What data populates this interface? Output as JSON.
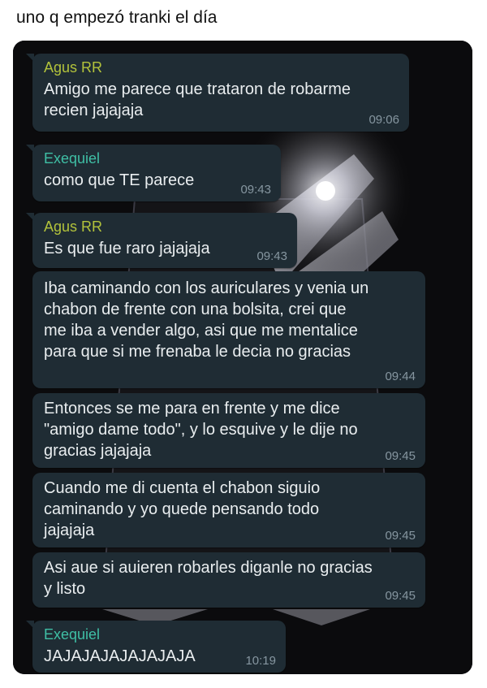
{
  "post": {
    "caption": "uno q empezó tranki el día"
  },
  "chat": {
    "messages": [
      {
        "sender": "Agus RR",
        "text": "Amigo me parece que trataron de robarme\nrecien jajajaja",
        "time": "09:06"
      },
      {
        "sender": "Exequiel",
        "text": "como que TE parece",
        "time": "09:43"
      },
      {
        "sender": "Agus RR",
        "text": "Es que fue raro jajajaja",
        "time": "09:43"
      },
      {
        "sender": "",
        "text": "Iba caminando con los auriculares y venia un\nchabon de frente con una bolsita, crei que\nme iba a vender algo, asi que me mentalice\npara que si me frenaba le decia no gracias",
        "time": "09:44"
      },
      {
        "sender": "",
        "text": "Entonces se me para en frente y me dice\n\"amigo dame todo\", y lo esquive y le dije no\ngracias jajajaja",
        "time": "09:45"
      },
      {
        "sender": "",
        "text": "Cuando me di cuenta el chabon siguio\ncaminando y yo quede pensando todo\njajajaja",
        "time": "09:45"
      },
      {
        "sender": "",
        "text": "Asi aue si auieren robarles diganle no gracias\ny listo",
        "time": "09:45"
      },
      {
        "sender": "Exequiel",
        "text": "JAJAJAJAJAJAJAJA",
        "time": "10:19"
      }
    ]
  }
}
